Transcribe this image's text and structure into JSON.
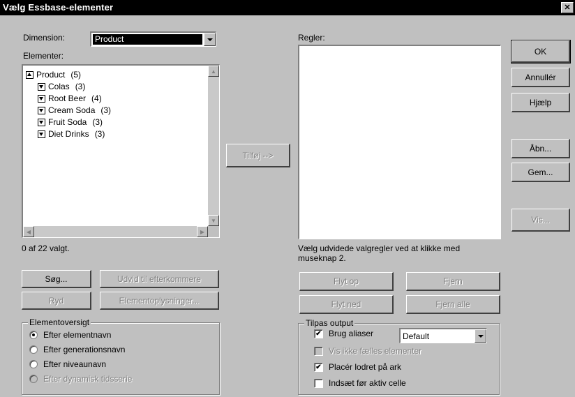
{
  "window": {
    "title": "Vælg Essbase-elementer",
    "close_glyph": "✕"
  },
  "dimension": {
    "label": "Dimension:",
    "value": "Product"
  },
  "elements_label": "Elementer:",
  "tree": [
    {
      "label": "Product",
      "count": "(5)",
      "icon": "collapse-box-icon",
      "indent": 0
    },
    {
      "label": "Colas",
      "count": "(3)",
      "icon": "expand-box-icon",
      "indent": 1
    },
    {
      "label": "Root Beer",
      "count": "(4)",
      "icon": "expand-box-icon",
      "indent": 1
    },
    {
      "label": "Cream Soda",
      "count": "(3)",
      "icon": "expand-box-icon",
      "indent": 1
    },
    {
      "label": "Fruit Soda",
      "count": "(3)",
      "icon": "expand-box-icon",
      "indent": 1
    },
    {
      "label": "Diet Drinks",
      "count": "(3)",
      "icon": "expand-box-icon",
      "indent": 1
    }
  ],
  "selection_status": "0 af 22 valgt.",
  "buttons": {
    "search": "Søg...",
    "expand_descendants": "Udvid til efterkommere",
    "undo": "Ryd",
    "element_info": "Elementoplysninger...",
    "add": "Tilføj -->",
    "move_up": "Flyt op",
    "remove": "Fjern",
    "move_down": "Flyt ned",
    "remove_all": "Fjern alle",
    "ok": "OK",
    "cancel": "Annullér",
    "help": "Hjælp",
    "open": "Åbn...",
    "save": "Gem...",
    "show": "Vis..."
  },
  "rules": {
    "label": "Regler:",
    "hint": "Vælg udvidede valgregler ved at klikke med museknap 2."
  },
  "overview": {
    "title": "Elementoversigt",
    "options": [
      {
        "label": "Efter elementnavn",
        "selected": true,
        "disabled": false
      },
      {
        "label": "Efter generationsnavn",
        "selected": false,
        "disabled": false
      },
      {
        "label": "Efter niveaunavn",
        "selected": false,
        "disabled": false
      },
      {
        "label": "Efter dynamisk tidsserie",
        "selected": false,
        "disabled": true
      }
    ]
  },
  "output": {
    "title": "Tilpas output",
    "use_aliases": {
      "label": "Brug aliaser",
      "checked": true
    },
    "alias_table": "Default",
    "hide_shared": {
      "label": "Vis ikke fælles elementer",
      "checked": false,
      "disabled": true
    },
    "place_vertical": {
      "label": "Placér lodret på ark",
      "checked": true
    },
    "insert_before": {
      "label": "Indsæt før aktiv celle",
      "checked": false
    }
  }
}
